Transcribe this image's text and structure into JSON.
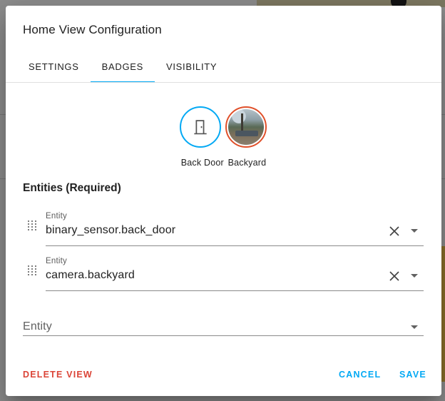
{
  "dialog": {
    "title": "Home View Configuration"
  },
  "tabs": [
    {
      "label": "SETTINGS",
      "active": false
    },
    {
      "label": "BADGES",
      "active": true
    },
    {
      "label": "VISIBILITY",
      "active": false
    }
  ],
  "badges": [
    {
      "label": "Back Door",
      "icon": "door-icon",
      "ring_color": "#03a9f4"
    },
    {
      "label": "Backyard",
      "icon": "camera-thumbnail",
      "ring_color": "#e0502a"
    }
  ],
  "entities_section": {
    "title": "Entities (Required)",
    "rows": [
      {
        "label": "Entity",
        "value": "binary_sensor.back_door"
      },
      {
        "label": "Entity",
        "value": "camera.backyard"
      }
    ],
    "new_entity_placeholder": "Entity"
  },
  "actions": {
    "delete_label": "DELETE VIEW",
    "cancel_label": "CANCEL",
    "save_label": "SAVE"
  },
  "colors": {
    "accent": "#03a9f4",
    "danger": "#db4437"
  }
}
